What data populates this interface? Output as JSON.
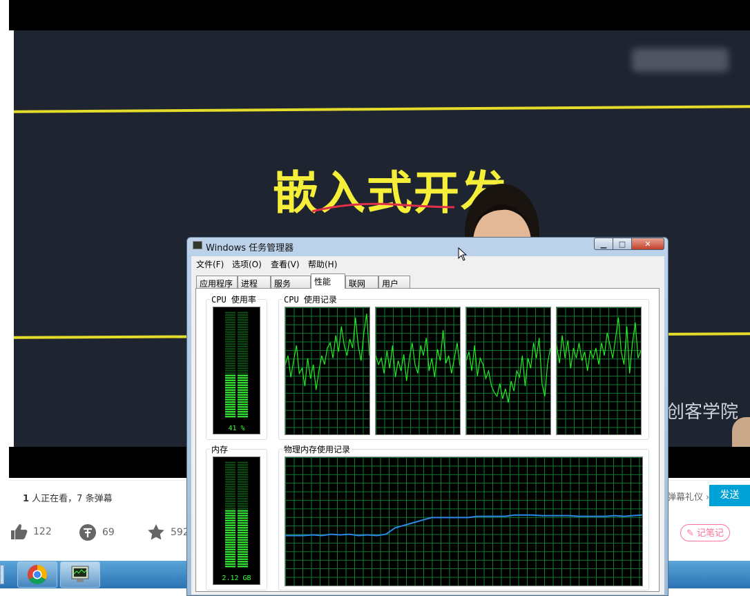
{
  "video": {
    "board_title": "嵌入式开发",
    "watermark": "创客学院"
  },
  "info_bar": {
    "viewers_count": "1",
    "viewers_text": " 人正在看，7 条弹幕",
    "etiquette_link": "弹幕礼仪 ›",
    "send_label": "发送"
  },
  "actions": {
    "like_count": "122",
    "coin_count": "69",
    "favorite_count": "592",
    "note_label": "记笔记"
  },
  "task_manager": {
    "title": "Windows 任务管理器",
    "menu": [
      "文件(F)",
      "选项(O)",
      "查看(V)",
      "帮助(H)"
    ],
    "tabs": [
      "应用程序",
      "进程",
      "服务",
      "性能",
      "联网",
      "用户"
    ],
    "active_tab": "性能",
    "cpu_usage_label": "CPU 使用率",
    "cpu_history_label": "CPU 使用记录",
    "memory_label": "内存",
    "memory_history_label": "物理内存使用记录",
    "cpu_usage_value": "41 %",
    "cpu_usage_fraction": 0.41,
    "memory_value": "2.12 GB",
    "memory_fraction": 0.55,
    "cpu_history": [
      [
        0.55,
        0.62,
        0.45,
        0.58,
        0.7,
        0.48,
        0.52,
        0.38,
        0.6,
        0.44,
        0.55,
        0.35,
        0.5,
        0.62,
        0.55,
        0.68,
        0.72,
        0.6,
        0.78,
        0.65,
        0.85,
        0.7,
        0.62,
        0.75,
        0.68,
        0.92,
        0.7,
        0.58,
        0.8,
        0.95,
        0.62
      ],
      [
        0.62,
        0.55,
        0.6,
        0.48,
        0.66,
        0.52,
        0.7,
        0.45,
        0.58,
        0.5,
        0.63,
        0.42,
        0.6,
        0.72,
        0.55,
        0.48,
        0.7,
        0.62,
        0.76,
        0.5,
        0.6,
        0.45,
        0.67,
        0.58,
        0.82,
        0.56,
        0.62,
        0.48,
        0.6,
        0.72,
        0.54
      ],
      [
        0.58,
        0.65,
        0.5,
        0.7,
        0.46,
        0.6,
        0.55,
        0.44,
        0.5,
        0.38,
        0.33,
        0.3,
        0.4,
        0.28,
        0.36,
        0.25,
        0.42,
        0.34,
        0.5,
        0.45,
        0.62,
        0.38,
        0.6,
        0.52,
        0.72,
        0.6,
        0.76,
        0.4,
        0.3,
        0.56,
        0.68
      ],
      [
        0.7,
        0.56,
        0.78,
        0.6,
        0.74,
        0.52,
        0.68,
        0.6,
        0.72,
        0.58,
        0.65,
        0.5,
        0.66,
        0.6,
        0.68,
        0.55,
        0.72,
        0.62,
        0.8,
        0.7,
        0.6,
        0.76,
        0.92,
        0.65,
        0.55,
        0.85,
        0.48,
        0.72,
        0.88,
        0.6,
        0.66
      ]
    ],
    "memory_history": [
      0.39,
      0.39,
      0.39,
      0.395,
      0.39,
      0.4,
      0.395,
      0.4,
      0.39,
      0.395,
      0.39,
      0.4,
      0.45,
      0.47,
      0.49,
      0.51,
      0.53,
      0.53,
      0.53,
      0.53,
      0.53,
      0.54,
      0.54,
      0.54,
      0.54,
      0.55,
      0.55,
      0.55,
      0.545,
      0.545,
      0.545,
      0.545,
      0.54,
      0.54,
      0.54,
      0.54,
      0.545,
      0.54,
      0.545,
      0.55
    ]
  },
  "colors": {
    "graph_line": "#22ee22",
    "memory_line": "#2b88e8",
    "send_button": "#00a1d6",
    "note_accent": "#fb7299"
  }
}
